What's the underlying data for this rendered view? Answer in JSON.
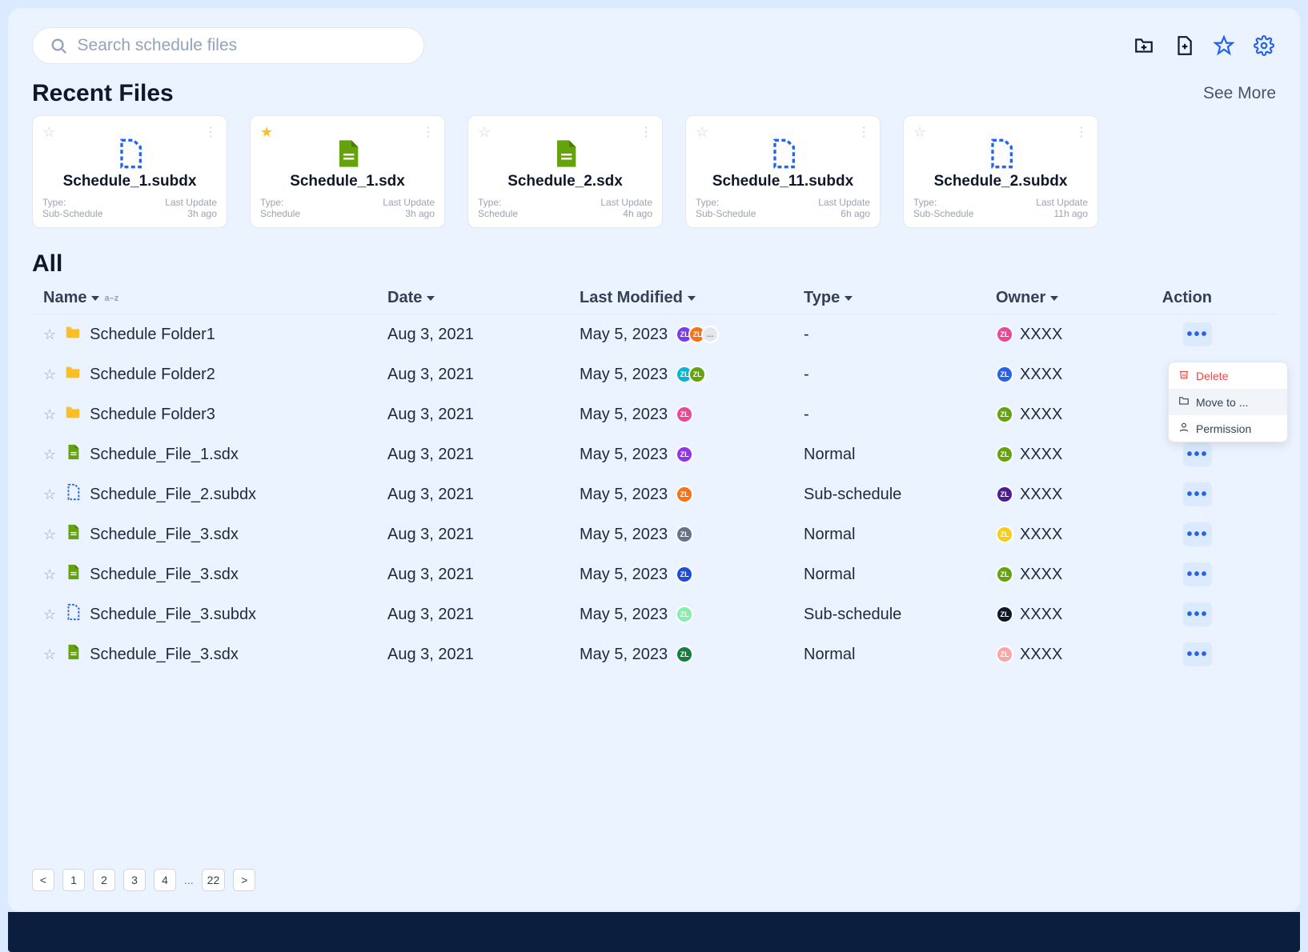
{
  "search": {
    "placeholder": "Search schedule files"
  },
  "sections": {
    "recent": "Recent Files",
    "all": "All"
  },
  "see_more": "See More",
  "cards": [
    {
      "name": "Schedule_1.subdx",
      "type_label": "Type:",
      "type_value": "Sub-Schedule",
      "update_label": "Last Update",
      "update_value": "3h ago",
      "starred": false,
      "icon": "subdx"
    },
    {
      "name": "Schedule_1.sdx",
      "type_label": "Type:",
      "type_value": "Schedule",
      "update_label": "Last Update",
      "update_value": "3h ago",
      "starred": true,
      "icon": "sdx"
    },
    {
      "name": "Schedule_2.sdx",
      "type_label": "Type:",
      "type_value": "Schedule",
      "update_label": "Last Update",
      "update_value": "4h ago",
      "starred": false,
      "icon": "sdx"
    },
    {
      "name": "Schedule_11.subdx",
      "type_label": "Type:",
      "type_value": "Sub-Schedule",
      "update_label": "Last Update",
      "update_value": "6h ago",
      "starred": false,
      "icon": "subdx"
    },
    {
      "name": "Schedule_2.subdx",
      "type_label": "Type:",
      "type_value": "Sub-Schedule",
      "update_label": "Last Update",
      "update_value": "11h ago",
      "starred": false,
      "icon": "subdx"
    }
  ],
  "columns": {
    "name": "Name",
    "date": "Date",
    "modified": "Last Modified",
    "type": "Type",
    "owner": "Owner",
    "action": "Action",
    "sort_hint": "a–z"
  },
  "rows": [
    {
      "icon": "folder",
      "name": "Schedule Folder1",
      "date": "Aug 3, 2021",
      "modified": "May 5, 2023",
      "avatars": [
        "#7c3aed",
        "#f97316"
      ],
      "avatar_more": "…",
      "type": "-",
      "owner": "XXXX",
      "owner_color": "#ec4899"
    },
    {
      "icon": "folder",
      "name": "Schedule Folder2",
      "date": "Aug 3, 2021",
      "modified": "May 5, 2023",
      "avatars": [
        "#06b6d4",
        "#65a30d"
      ],
      "type": "-",
      "owner": "XXXX",
      "owner_color": "#2563eb"
    },
    {
      "icon": "folder",
      "name": "Schedule Folder3",
      "date": "Aug 3, 2021",
      "modified": "May 5, 2023",
      "avatars": [
        "#ec4899"
      ],
      "type": "-",
      "owner": "XXXX",
      "owner_color": "#65a30d"
    },
    {
      "icon": "sdx",
      "name": "Schedule_File_1.sdx",
      "date": "Aug 3, 2021",
      "modified": "May 5, 2023",
      "avatars": [
        "#9333ea"
      ],
      "type": "Normal",
      "owner": "XXXX",
      "owner_color": "#65a30d"
    },
    {
      "icon": "subdx",
      "name": "Schedule_File_2.subdx",
      "date": "Aug 3, 2021",
      "modified": "May 5, 2023",
      "avatars": [
        "#f97316"
      ],
      "type": "Sub-schedule",
      "owner": "XXXX",
      "owner_color": "#4c1d95"
    },
    {
      "icon": "sdx",
      "name": "Schedule_File_3.sdx",
      "date": "Aug 3, 2021",
      "modified": "May 5, 2023",
      "avatars": [
        "#64748b"
      ],
      "type": "Normal",
      "owner": "XXXX",
      "owner_color": "#facc15"
    },
    {
      "icon": "sdx",
      "name": "Schedule_File_3.sdx",
      "date": "Aug 3, 2021",
      "modified": "May 5, 2023",
      "avatars": [
        "#1d4ed8"
      ],
      "type": "Normal",
      "owner": "XXXX",
      "owner_color": "#65a30d"
    },
    {
      "icon": "subdx",
      "name": "Schedule_File_3.subdx",
      "date": "Aug 3, 2021",
      "modified": "May 5, 2023",
      "avatars": [
        "#86efac"
      ],
      "type": "Sub-schedule",
      "owner": "XXXX",
      "owner_color": "#0f172a"
    },
    {
      "icon": "sdx",
      "name": "Schedule_File_3.sdx",
      "date": "Aug 3, 2021",
      "modified": "May 5, 2023",
      "avatars": [
        "#15803d"
      ],
      "type": "Normal",
      "owner": "XXXX",
      "owner_color": "#fca5a5"
    }
  ],
  "avatar_label": "ZL",
  "context_menu": {
    "delete": "Delete",
    "move": "Move to ...",
    "permission": "Permission"
  },
  "pagination": {
    "prev": "<",
    "next": ">",
    "pages": [
      "1",
      "2",
      "3",
      "4"
    ],
    "last": "22"
  }
}
